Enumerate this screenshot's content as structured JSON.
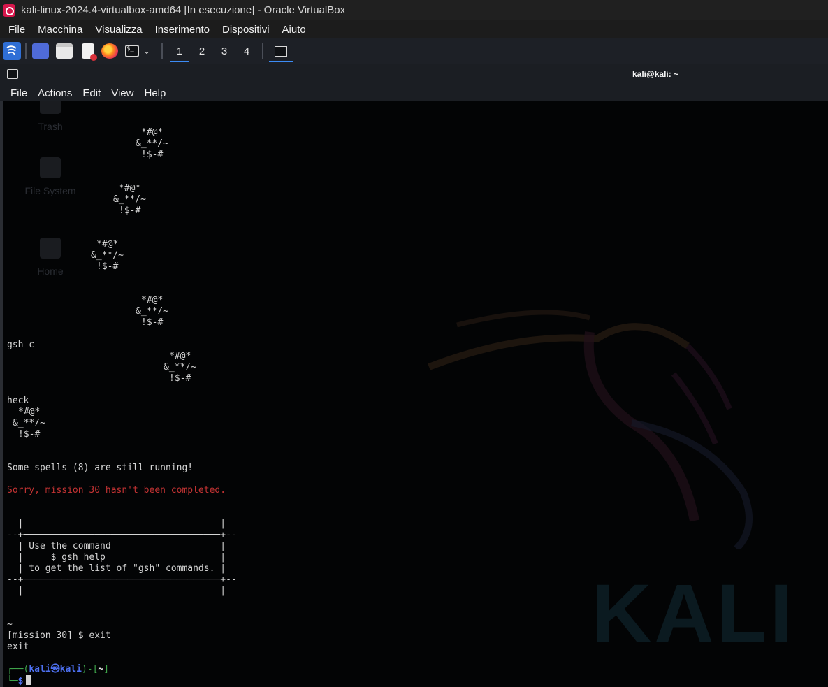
{
  "vbox": {
    "title": "kali-linux-2024.4-virtualbox-amd64 [In esecuzione] - Oracle VirtualBox",
    "menu": [
      "File",
      "Macchina",
      "Visualizza",
      "Inserimento",
      "Dispositivi",
      "Aiuto"
    ]
  },
  "panel": {
    "workspaces": [
      "1",
      "2",
      "3",
      "4"
    ],
    "active_workspace": "1",
    "icons": [
      "kali-menu-icon",
      "desktop-icon",
      "file-manager-icon",
      "text-editor-icon",
      "firefox-icon",
      "terminal-icon"
    ]
  },
  "terminal": {
    "title": "kali@kali: ~",
    "menu": [
      "File",
      "Actions",
      "Edit",
      "View",
      "Help"
    ]
  },
  "desktop_ghost": [
    "Trash",
    "File System",
    "Home"
  ],
  "watermark": "KALI",
  "output": {
    "spell1": [
      "*#@*",
      "&_**/~",
      "!$-#"
    ],
    "spell2": [
      "*#@*",
      "&_**/~",
      "!$-#"
    ],
    "spell3": [
      "*#@*",
      "&_**/~",
      "!$-#"
    ],
    "spell4": [
      "*#@*",
      "&_**/~",
      "!$-#"
    ],
    "gsh_c": "gsh c",
    "spell5": [
      "*#@*",
      "&_**/~",
      "!$-#"
    ],
    "heck": "heck",
    "spell6": [
      "*#@*",
      "&_**/~",
      "!$-#"
    ],
    "running": "Some spells (8) are still running!",
    "sorry": "Sorry, mission 30 hasn't been completed.",
    "box": [
      "  |                                    |",
      "--+────────────────────────────────────+--",
      "  | Use the command                    |",
      "  |     $ gsh help                     |",
      "  | to get the list of \"gsh\" commands. |",
      "--+────────────────────────────────────+--",
      "  |                                    |"
    ],
    "tilde": "~",
    "mission_prompt": "[mission 30] $ exit",
    "exit": "exit"
  },
  "prompt": {
    "open": "┌──(",
    "user": "kali㉿kali",
    "mid": ")-[",
    "dir": "~",
    "close": "]",
    "line2": "└─",
    "dollar": "$"
  }
}
